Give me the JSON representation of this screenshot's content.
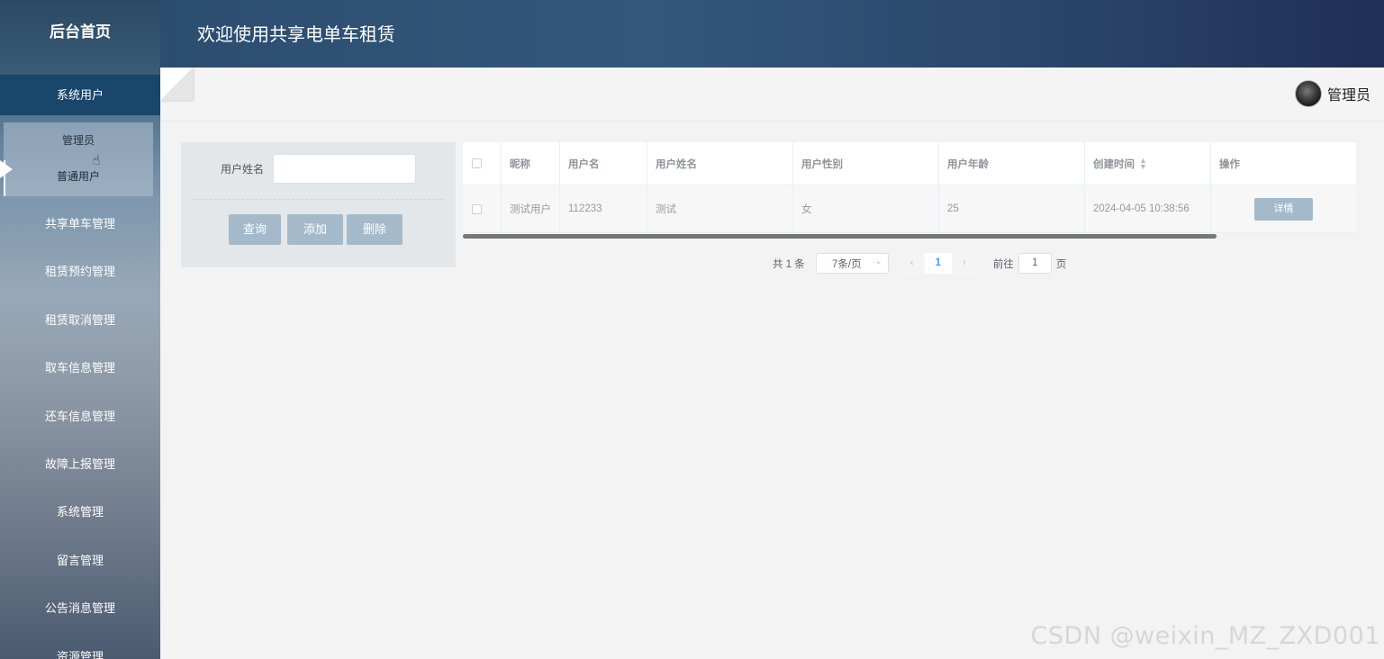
{
  "sidebar": {
    "brand": "后台首页",
    "group": "系统用户",
    "sub_items": [
      {
        "label": "管理员"
      },
      {
        "label": "普通用户"
      }
    ],
    "menu": [
      {
        "label": "共享单车管理"
      },
      {
        "label": "租赁预约管理"
      },
      {
        "label": "租赁取消管理"
      },
      {
        "label": "取车信息管理"
      },
      {
        "label": "还车信息管理"
      },
      {
        "label": "故障上报管理"
      },
      {
        "label": "系统管理"
      },
      {
        "label": "留言管理"
      },
      {
        "label": "公告消息管理"
      },
      {
        "label": "资源管理"
      }
    ]
  },
  "header": {
    "title": "欢迎使用共享电单车租赁"
  },
  "user": {
    "name": "管理员"
  },
  "search": {
    "label": "用户姓名",
    "value": "",
    "buttons": {
      "query": "查询",
      "add": "添加",
      "delete": "删除"
    }
  },
  "table": {
    "columns": [
      "昵称",
      "用户名",
      "用户姓名",
      "用户性别",
      "用户年龄",
      "创建时间",
      "操作"
    ],
    "rows": [
      {
        "nickname": "测试用户",
        "username": "112233",
        "name": "测试",
        "gender": "女",
        "age": "25",
        "created": "2024-04-05 10:38:56",
        "action": "详情"
      }
    ]
  },
  "pagination": {
    "total": "共 1 条",
    "page_size": "7条/页",
    "current": "1",
    "goto_prefix": "前往",
    "goto_value": "1",
    "goto_suffix": "页",
    "prev": "‹",
    "next": "›"
  },
  "watermark": "CSDN @weixin_MZ_ZXD001"
}
